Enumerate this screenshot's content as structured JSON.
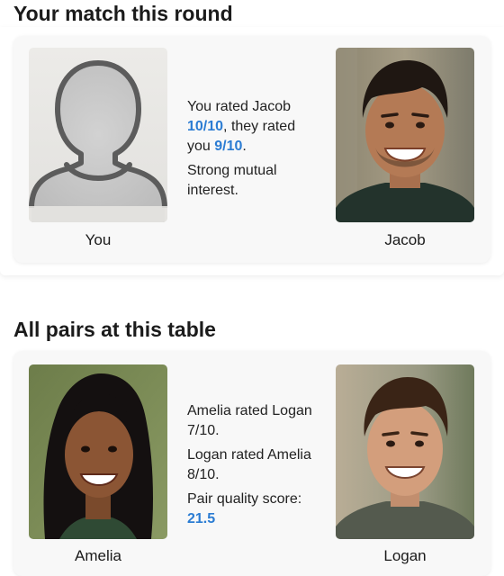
{
  "match": {
    "section_title": "Your match this round",
    "you_label": "You",
    "partner_label": "Jacob",
    "line1_prefix": "You rated Jacob ",
    "you_rating": "10/10",
    "line1_mid": ", they rated you ",
    "their_rating": "9/10",
    "line1_suffix": ".",
    "line2": "Strong mutual interest."
  },
  "table": {
    "section_title": "All pairs at this table",
    "left_label": "Amelia",
    "right_label": "Logan",
    "line1": "Amelia rated Logan 7/10.",
    "line2": "Logan rated Amelia 8/10.",
    "score_label": "Pair quality score:",
    "score_value": "21.5"
  },
  "colors": {
    "accent": "#2b7cd3",
    "card_background": "#f8f8f8"
  }
}
